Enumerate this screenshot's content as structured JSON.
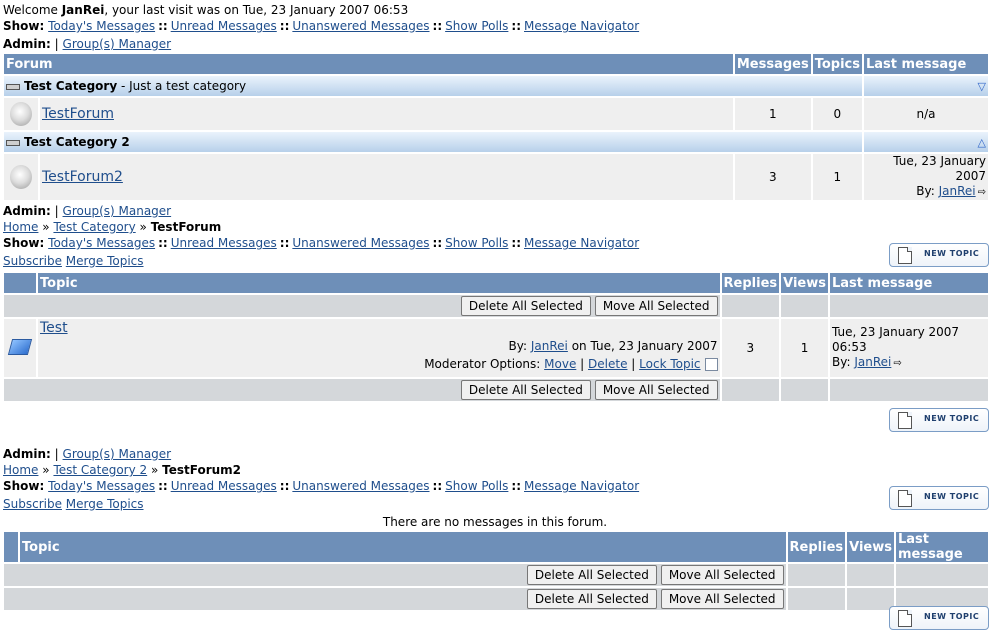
{
  "welcome": {
    "prefix": "Welcome ",
    "user": "JanRei",
    "suffix": ", your last visit was on Tue, 23 January 2007 06:53"
  },
  "labels": {
    "show": "Show:",
    "admin": "Admin:",
    "pipe": "|",
    "dsep": "::",
    "crumb_sep": "»",
    "by": "By:"
  },
  "show_links": [
    "Today's Messages",
    "Unread Messages",
    "Unanswered Messages",
    "Show Polls",
    "Message Navigator"
  ],
  "admin_link": "Group(s) Manager",
  "forum_table": {
    "headers": [
      "Forum",
      "Messages",
      "Topics",
      "Last message"
    ],
    "categories": [
      {
        "name": "Test Category",
        "desc": " - Just a test category",
        "forum": "TestForum",
        "messages": "1",
        "topics": "0",
        "last": "n/a",
        "toggle": "▽"
      },
      {
        "name": "Test Category 2",
        "desc": "",
        "forum": "TestForum2",
        "messages": "3",
        "topics": "1",
        "last_date": "Tue, 23 January 2007",
        "last_by": "JanRei",
        "toggle": "△"
      }
    ]
  },
  "section1": {
    "home": "Home",
    "category": "Test Category",
    "forum": "TestForum",
    "subscribe": "Subscribe",
    "merge": "Merge Topics"
  },
  "topic_table": {
    "headers": [
      "Topic",
      "Replies",
      "Views",
      "Last message"
    ],
    "delete_all": "Delete All Selected",
    "move_all": "Move All Selected",
    "topic": {
      "title": "Test",
      "by_prefix": "By: ",
      "author": "JanRei",
      "date": " on Tue, 23 January 2007",
      "replies": "3",
      "views": "1",
      "last_date": "Tue, 23 January 2007 06:53",
      "last_by": "JanRei"
    },
    "mod": {
      "label": "Moderator Options:",
      "move": "Move",
      "delete": "Delete",
      "lock": "Lock Topic"
    }
  },
  "new_topic_label": "NEW TOPIC",
  "section2": {
    "home": "Home",
    "category": "Test Category 2",
    "forum": "TestForum2",
    "subscribe": "Subscribe",
    "merge": "Merge Topics",
    "empty": "There are no messages in this forum."
  }
}
